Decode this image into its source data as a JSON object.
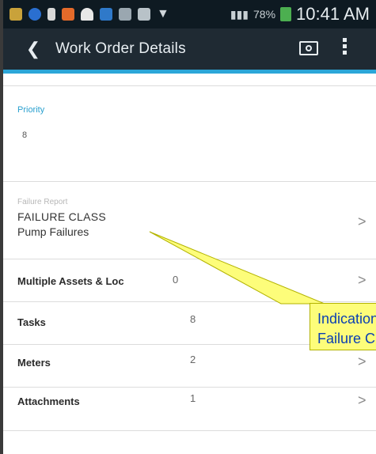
{
  "status_bar": {
    "time": "10:41 AM",
    "battery_text": "78%"
  },
  "app_bar": {
    "back_icon": "chevron-left-icon",
    "title": "Work Order Details",
    "camera_icon": "camera-icon",
    "menu_icon": "more-vert-icon"
  },
  "priority": {
    "label": "Priority",
    "value": "8"
  },
  "failure_report": {
    "label": "Failure Report",
    "line1": "FAILURE CLASS",
    "line2": "Pump Failures",
    "chevron": ">"
  },
  "rows": [
    {
      "label": "Multiple Assets & Loc",
      "count": "0",
      "chevron": ">"
    },
    {
      "label": "Tasks",
      "count": "8",
      "chevron": ">"
    },
    {
      "label": "Meters",
      "count": "2",
      "chevron": ">"
    },
    {
      "label": "Attachments",
      "count": "1",
      "chevron": ">"
    }
  ],
  "callout": {
    "line1": "Indication o",
    "line2": "Failure Clas",
    "fill_color": "#fdfd7a",
    "text_color": "#0a3fb3"
  },
  "colors": {
    "accent": "#2ba6d8",
    "app_bar": "#1f2a33",
    "status_bar": "#0e1a22"
  }
}
